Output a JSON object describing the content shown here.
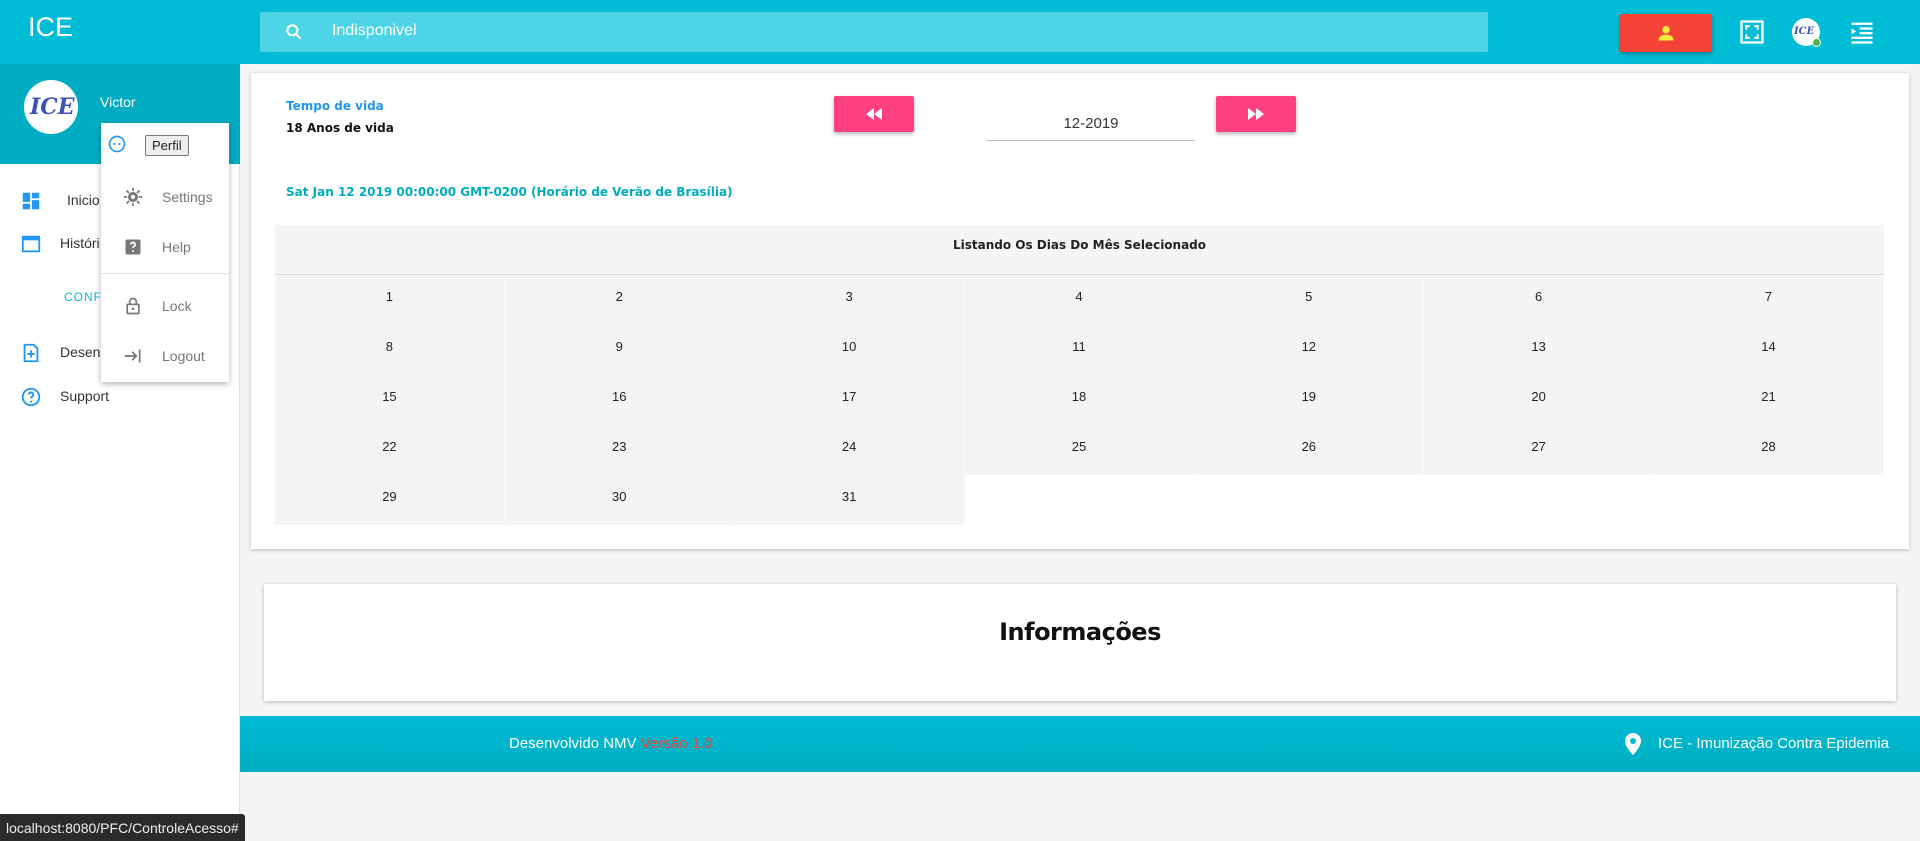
{
  "topbar": {
    "brand": "ICE",
    "search_text": "Indisponivel",
    "avatar_logo": "ICE"
  },
  "sidebar": {
    "user_name": "Victor",
    "avatar_logo": "ICE",
    "items": [
      {
        "label": "Inicio",
        "icon": "dashboard-icon"
      },
      {
        "label": "Históri",
        "icon": "history-icon"
      },
      {
        "label": "CONF",
        "icon": ""
      },
      {
        "label": "Desen",
        "icon": "add-document-icon"
      },
      {
        "label": "Support",
        "icon": "help-circle-icon"
      }
    ]
  },
  "menu": {
    "perfil": "Perfil",
    "items": [
      {
        "label": "Settings",
        "icon": "gear-icon"
      },
      {
        "label": "Help",
        "icon": "help-icon"
      },
      {
        "label": "Lock",
        "icon": "lock-icon"
      },
      {
        "label": "Logout",
        "icon": "logout-icon"
      }
    ]
  },
  "card": {
    "life_label": "Tempo de vida",
    "life_value": "18 Anos de vida",
    "month_value": "12-2019",
    "date_line": "Sat Jan 12 2019 00:00:00 GMT-0200 (Horário de Verão de Brasília)",
    "calendar_title": "Listando Os Dias Do Mês Selecionado",
    "days": [
      "1",
      "2",
      "3",
      "4",
      "5",
      "6",
      "7",
      "8",
      "9",
      "10",
      "11",
      "12",
      "13",
      "14",
      "15",
      "16",
      "17",
      "18",
      "19",
      "20",
      "21",
      "22",
      "23",
      "24",
      "25",
      "26",
      "27",
      "28",
      "29",
      "30",
      "31"
    ]
  },
  "info": {
    "title": "Informações"
  },
  "footer": {
    "dev": "Desenvolvido NMV",
    "version": "Versão 1.0",
    "right": "ICE - Imunização Contra Epidemia"
  },
  "statusbar": "localhost:8080/PFC/ControleAcesso#",
  "colors": {
    "primary": "#00bcd4",
    "accent": "#ff4081",
    "danger": "#f44336"
  }
}
